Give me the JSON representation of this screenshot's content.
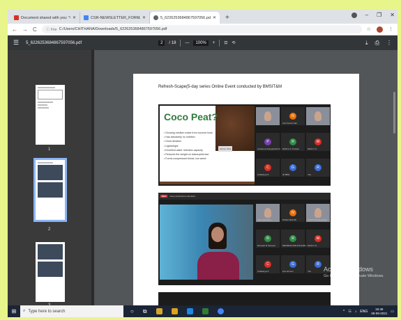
{
  "tabs": [
    {
      "label": "Document shared with you: \"CS...",
      "icon_color": "#d93025",
      "icon": "gmail-icon"
    },
    {
      "label": "CSR-NEWSLETTER_FORMAT - Goo...",
      "icon_color": "#4285f4",
      "icon": "docs-icon"
    },
    {
      "label": "5_6226253684867597056.pdf",
      "icon_color": "#5f6368",
      "icon": "globe-icon"
    }
  ],
  "new_tab": "+",
  "window_controls": {
    "minimize": "–",
    "maximize": "❐",
    "close": "✕",
    "menu": "⌄"
  },
  "address": {
    "prefix": "ⓘ File",
    "url": "C:/Users/CHITHANA/Downloads/5_6226253684867597056.pdf"
  },
  "nav": {
    "back": "←",
    "forward": "→",
    "reload": "C"
  },
  "pdf": {
    "filename": "5_6226253684867597056.pdf",
    "page_current": "2",
    "page_total": "/ 18",
    "zoom": "100%",
    "zoom_out": "—",
    "zoom_in": "+"
  },
  "thumbs": [
    "1",
    "2",
    "3"
  ],
  "page": {
    "heading": "Refresh-Scape(5-day series Online Event conducted by BMSIT&M",
    "slide": {
      "title": "Coco Peat?",
      "bullets": [
        "• Growing medium made from coconut husk",
        "• Has absolutely no nutrition",
        "• Good aeration",
        "• Lightweight",
        "• Excellent water retention capacity",
        "• Reduces the weight on balcony/terrace",
        "• Forms compressed bricks, low weed"
      ],
      "screenshot_label": "Screen Shot"
    },
    "panel1_tiles": [
      {
        "initial": "",
        "name": "",
        "color": "#8b8f9a",
        "video": true
      },
      {
        "initial": "N",
        "name": "Anil Kumar Nair",
        "color": "#e8710a"
      },
      {
        "initial": "",
        "name": "",
        "color": "#8b8f9a",
        "video": true
      },
      {
        "initial": "P",
        "name": "prasanna thangarekshmi",
        "color": "#7b3fb3"
      },
      {
        "initial": "R",
        "name": "Rathna S. Prasad",
        "color": "#2f8f46"
      },
      {
        "initial": "M",
        "name": "Muhil C.S.",
        "color": "#d93025"
      },
      {
        "initial": "C",
        "name": "Chaitanya S",
        "color": "#d93025"
      },
      {
        "initial": "G",
        "name": "ID 8891",
        "color": "#3a6fd8"
      },
      {
        "initial": "R",
        "name": "You",
        "color": "#3a6fd8"
      }
    ],
    "panel2_bar": {
      "rec": "REC",
      "title": "www.mitsolutions.education"
    },
    "panel2_tiles": [
      {
        "initial": "",
        "name": "Vasu saravana",
        "color": "#8b8f9a",
        "video": true
      },
      {
        "initial": "N",
        "name": "NISHA MALINI",
        "color": "#e8710a"
      },
      {
        "initial": "",
        "name": "Anand Subramaniam",
        "color": "#8b8f9a",
        "video": true
      },
      {
        "initial": "R",
        "name": "Ramesh R Kanupur",
        "color": "#2f8f46"
      },
      {
        "initial": "R",
        "name": "REFRESCAPE RAHUMANB",
        "color": "#2f8f46"
      },
      {
        "initial": "M",
        "name": "Muhil C.S.",
        "color": "#d93025"
      },
      {
        "initial": "C",
        "name": "Chaitanya S",
        "color": "#d93025"
      },
      {
        "initial": "G",
        "name": "Zoe shimon",
        "color": "#3a6fd8"
      },
      {
        "initial": "R",
        "name": "You",
        "color": "#3a6fd8"
      }
    ]
  },
  "watermark": {
    "title": "Activate Windows",
    "subtitle": "Go to Settings to activate Windows."
  },
  "taskbar": {
    "search_placeholder": "Type here to search",
    "tray_lang": "ENG",
    "time": "15:48",
    "date": "28-09-2021"
  }
}
